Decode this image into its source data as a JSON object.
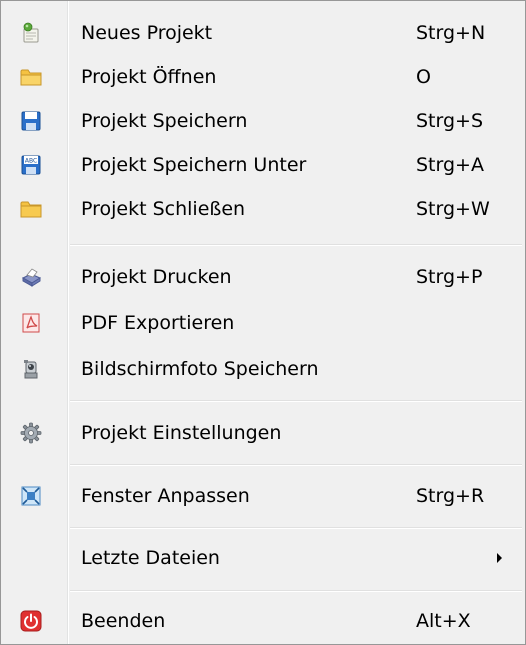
{
  "menu": {
    "items": [
      {
        "label": "Neues Projekt",
        "shortcut": "Strg+N",
        "icon": "new-project-icon"
      },
      {
        "label": "Projekt Öffnen",
        "shortcut": "O",
        "icon": "folder-open-icon"
      },
      {
        "label": "Projekt Speichern",
        "shortcut": "Strg+S",
        "icon": "floppy-disk-icon"
      },
      {
        "label": "Projekt Speichern Unter",
        "shortcut": "Strg+A",
        "icon": "floppy-disk-abc-icon"
      },
      {
        "label": "Projekt Schließen",
        "shortcut": "Strg+W",
        "icon": "folder-close-icon"
      },
      {
        "label": "Projekt Drucken",
        "shortcut": "Strg+P",
        "icon": "printer-icon"
      },
      {
        "label": "PDF Exportieren",
        "shortcut": "",
        "icon": "pdf-icon"
      },
      {
        "label": "Bildschirmfoto Speichern",
        "shortcut": "",
        "icon": "camera-icon"
      },
      {
        "label": "Projekt Einstellungen",
        "shortcut": "",
        "icon": "gear-icon"
      },
      {
        "label": "Fenster Anpassen",
        "shortcut": "Strg+R",
        "icon": "fit-window-icon"
      },
      {
        "label": "Letzte Dateien",
        "shortcut": "",
        "icon": ""
      },
      {
        "label": "Beenden",
        "shortcut": "Alt+X",
        "icon": "power-icon"
      }
    ]
  },
  "colors": {
    "menu_background": "#f0f0f0",
    "border": "#979797",
    "separator": "#e0e0e0",
    "folder": "#f5c242",
    "floppy": "#2a6fc9",
    "power": "#e03030"
  }
}
